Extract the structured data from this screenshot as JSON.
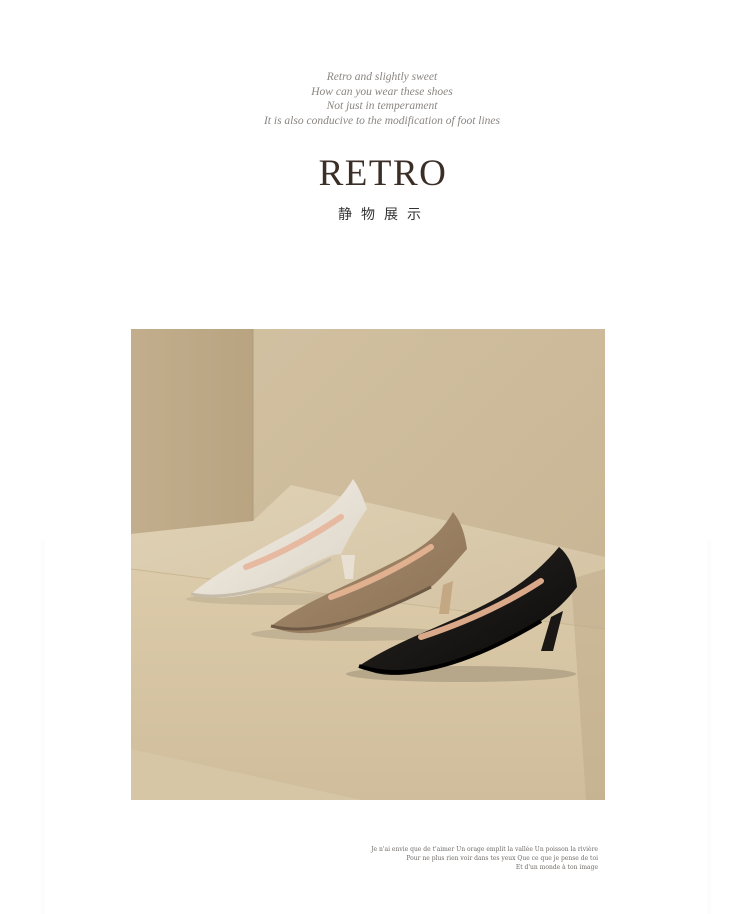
{
  "intro": {
    "lines": [
      "Retro and slightly sweet",
      "How can you wear these shoes",
      "Not just in temperament",
      "It is also conducive to the modification of foot lines"
    ]
  },
  "heading": {
    "title": "RETRO",
    "subtitle": "静物展示"
  },
  "footer": {
    "lines": [
      "Je n'ai envie que de t'aimer Un orage emplit la vallée Un poisson la rivière",
      "Pour ne plus rien voir dans tes yeux Que ce que je pense de toi",
      "Et d'un monde à ton image"
    ]
  },
  "colors": {
    "background": "#ffffff",
    "title": "#3b2e26",
    "poem_text": "#8a8580",
    "photo_backdrop": "#cbb998",
    "shoe_white": "#ece6dc",
    "shoe_taupe": "#9a8064",
    "shoe_black": "#141210"
  }
}
